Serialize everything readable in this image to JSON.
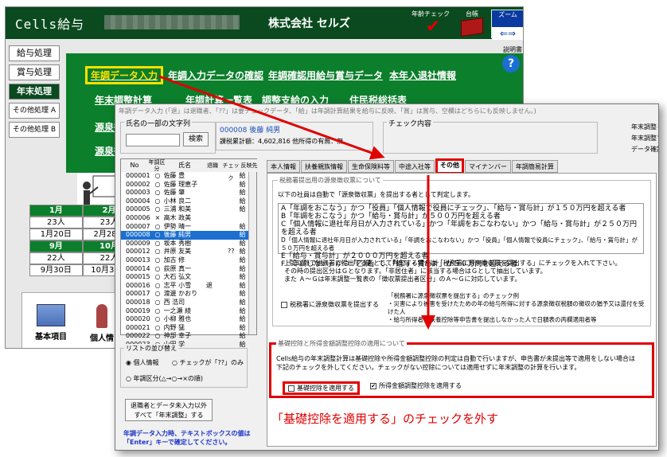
{
  "app": {
    "title": "Cells給与",
    "company": "株式会社 セルズ",
    "nenrei_check": "年齢チェック",
    "daicho": "台帳",
    "zoom": "ズーム",
    "zoom_arrows": "⇐⇒"
  },
  "sidebar": {
    "items": [
      {
        "label": "給与処理"
      },
      {
        "label": "賞与処理"
      },
      {
        "label": "年末処理"
      },
      {
        "label": "その他処理 A"
      },
      {
        "label": "その他処理 B"
      }
    ]
  },
  "green_menu": {
    "items": [
      {
        "label": "年調データ入力"
      },
      {
        "label": "年調入力データの確認"
      },
      {
        "label": "年調確認用給与賞与データ"
      },
      {
        "label": "本年入退社情報"
      },
      {
        "label": "年末調整計算"
      },
      {
        "label": "年調計算一覧表"
      },
      {
        "label": "調整支給の入力"
      },
      {
        "label": "住民税総括表"
      },
      {
        "label": "源泉徴"
      },
      {
        "label": "源泉徴"
      }
    ]
  },
  "help": {
    "label": "説明書",
    "icon": "?"
  },
  "calendar": {
    "row1": [
      "1月",
      "2月",
      "3"
    ],
    "row2": [
      "23人",
      "23人",
      ""
    ],
    "row3": [
      "1月20日",
      "2月28日",
      "3"
    ],
    "row4": [
      "9月",
      "10月",
      "1"
    ],
    "row5": [
      "22人",
      "22人",
      ""
    ],
    "row6": [
      "9月30日",
      "10月31日",
      "11"
    ]
  },
  "tiles": {
    "kihon": "基本項目",
    "kojin": "個人情"
  },
  "front": {
    "note": "年調データ入力 (「退」は退職者、「??」は要チェックデータ、「給」は年調計算結果を給与に反映、「賞」は賞与、空欄はどちらにも反映しません。)",
    "search": {
      "label": "氏名の一部の文字列",
      "button": "検索"
    },
    "employee": {
      "header": "000008 後藤 純男",
      "kazei": "課税累計額：4,602,816 他所得の有無：無"
    },
    "check": {
      "label": "チェック内容"
    },
    "right_info": [
      "年末調整し",
      "年末調整す",
      "データ確認"
    ]
  },
  "list": {
    "headers": [
      "No",
      "年調区分",
      "氏名",
      "退職",
      "チェック",
      "反映先"
    ],
    "rows": [
      {
        "no": "000001",
        "kbn": "○",
        "name": "佐藤 豊",
        "tai": "",
        "chk": "",
        "han": "給"
      },
      {
        "no": "000002",
        "kbn": "○",
        "name": "佐藤 理恵子",
        "tai": "",
        "chk": "",
        "han": "給"
      },
      {
        "no": "000003",
        "kbn": "○",
        "name": "佐藤 肇",
        "tai": "",
        "chk": "",
        "han": "給"
      },
      {
        "no": "000004",
        "kbn": "○",
        "name": "小林 良二",
        "tai": "",
        "chk": "",
        "han": "給"
      },
      {
        "no": "000005",
        "kbn": "○",
        "name": "三浦 和美",
        "tai": "",
        "chk": "",
        "han": "給"
      },
      {
        "no": "000006",
        "kbn": "×",
        "name": "高木 政美",
        "tai": "",
        "chk": "",
        "han": ""
      },
      {
        "no": "000007",
        "kbn": "○",
        "name": "伊勢 晴一",
        "tai": "",
        "chk": "",
        "han": "給"
      },
      {
        "no": "000008",
        "kbn": "○",
        "name": "後藤 純男",
        "tai": "",
        "chk": "",
        "han": "給"
      },
      {
        "no": "000009",
        "kbn": "○",
        "name": "坂本 秀樹",
        "tai": "",
        "chk": "",
        "han": "給"
      },
      {
        "no": "000012",
        "kbn": "○",
        "name": "井原 友美",
        "tai": "",
        "chk": "??",
        "han": "給"
      },
      {
        "no": "000013",
        "kbn": "○",
        "name": "加古 修",
        "tai": "",
        "chk": "",
        "han": "給"
      },
      {
        "no": "000014",
        "kbn": "○",
        "name": "荻原 真一",
        "tai": "",
        "chk": "",
        "han": "給"
      },
      {
        "no": "000015",
        "kbn": "○",
        "name": "大石 弘文",
        "tai": "",
        "chk": "",
        "han": "給"
      },
      {
        "no": "000016",
        "kbn": "○",
        "name": "志平 小雪",
        "tai": "退",
        "chk": "",
        "han": "給"
      },
      {
        "no": "000017",
        "kbn": "○",
        "name": "渡邊 かおり",
        "tai": "",
        "chk": "",
        "han": "給"
      },
      {
        "no": "000018",
        "kbn": "○",
        "name": "西 浩司",
        "tai": "",
        "chk": "",
        "han": "給"
      },
      {
        "no": "000019",
        "kbn": "○",
        "name": "一之瀬 綾",
        "tai": "",
        "chk": "",
        "han": "給"
      },
      {
        "no": "000020",
        "kbn": "○",
        "name": "小柳 雅也",
        "tai": "",
        "chk": "",
        "han": "給"
      },
      {
        "no": "000021",
        "kbn": "○",
        "name": "内野 猛",
        "tai": "",
        "chk": "",
        "han": "給"
      },
      {
        "no": "000022",
        "kbn": "○",
        "name": "神部 幸子",
        "tai": "",
        "chk": "",
        "han": "給"
      },
      {
        "no": "000023",
        "kbn": "○",
        "name": "山田 学",
        "tai": "",
        "chk": "",
        "han": "給"
      }
    ]
  },
  "sort": {
    "label": "リストの並び替え",
    "opt1": "個人情報",
    "opt2": "チェックが「??」のみ",
    "opt3": "年調区分(△→○→×の順)"
  },
  "btn_all": {
    "line1": "退職者とデータ未入力以外",
    "line2": "すべて「年末調整」する"
  },
  "blue_note": {
    "line1": "年調データ入力時、テキストボックスの値は",
    "line2": "「Enter」キーで確定してください。"
  },
  "tabs": [
    {
      "label": "本人情報"
    },
    {
      "label": "扶養親族情報"
    },
    {
      "label": "生命保険料等"
    },
    {
      "label": "中途入社等"
    },
    {
      "label": "その他"
    },
    {
      "label": "マイナンバー"
    },
    {
      "label": "年調簡易計算"
    }
  ],
  "gensen": {
    "title": "税務署提出用の源泉徴収票について",
    "intro": "以下の社員は自動で「源泉徴収票」を提出する者として判定します。",
    "criteria": [
      "A「年調をおこなう」かつ「役員」「個人情報で役員にチェック」、「給与・賞与計」が１５０万円を超える者",
      "B「年調をおこなう」かつ「給与・賞与計」が５００万円を超える者",
      "C「個人情報に退社年月日が入力されている」かつ「年調をおこなわない」かつ「給与・賞与計」が２５０万円を超える者",
      "D「個人情報に退社年月日が入力されている」「年調をおこなわない」かつ「役員」「個人情報で役員にチェック」、「給与・賞与計」が５０万円を超える者",
      "E「給与・賞与計」が２０００万円を超える者",
      "F「年調しない」かつ「乙欄」で、「給与・賞与計」が５０万円を超える者"
    ],
    "note1": "上記以外で税務署に提出する者として判定する場合は「税務署に源泉徴収票を提出する」にチェックを入れて下さい。",
    "note2": "その時の提出区分はＧとなります。「非居住者」に該当する場合はＧとして抽出しています。",
    "note3": "また Ａ～Ｇは年末調整一覧表の「徴収票提出者区分」のＡ～Ｇに対応しています。",
    "checkbox": "税務署に源泉徴収票を提出する",
    "ex_title": "「税務署に源泉徴収票を提出する」のチェック例",
    "ex1": "・災害により被害を受けたための年の給与所得に対する源泉徴収税額の徴収の猶予又は還付を受けた人",
    "ex2": "・給与所得者の扶養控除等申告書を提出しなかった人で日額表の丙欄適用者等"
  },
  "kiso": {
    "title": "基礎控除と所得金額調整控除の適用について",
    "desc1": "Cells給与の年末調整計算は基礎控除や所得金額調整控除の判定は自動で行いますが、申告書が未提出等で適用をしない場合は",
    "desc2": "下記のチェックを外してください。チェックがない控除については適用せずに年末調整の計算を行います。",
    "kiso_cb": "基礎控除を適用する",
    "shotoku_cb": "所得金額調整控除を適用する",
    "shotoku_mark": "✔"
  },
  "caption": "「基礎控除を適用する」のチェックを外す",
  "colors": {
    "dark_green": "#0a4a1e",
    "menu_green": "#0b7f2b",
    "highlight_red": "#e00000",
    "link_blue": "#1a33c8"
  }
}
